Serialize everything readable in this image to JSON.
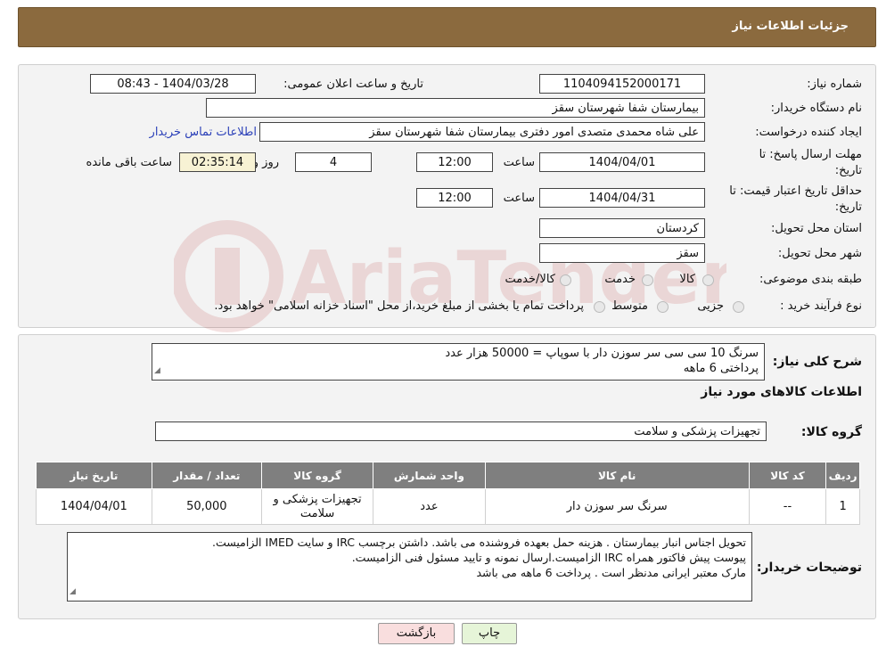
{
  "header": {
    "title": "جزئیات اطلاعات نیاز"
  },
  "fields": {
    "need_number_label": "شماره نیاز:",
    "need_number": "1104094152000171",
    "announce_label": "تاریخ و ساعت اعلان عمومی:",
    "announce_value": "1404/03/28 - 08:43",
    "buyer_org_label": "نام دستگاه خریدار:",
    "buyer_org": "بیمارستان شفا شهرستان سقز",
    "requester_label": "ایجاد کننده درخواست:",
    "requester": "علی شاه محمدی متصدی امور دفتری بیمارستان شفا شهرستان سقز",
    "contact_link": "اطلاعات تماس خریدار",
    "deadline_label_1": "مهلت ارسال پاسخ: تا",
    "deadline_label_2": "تاریخ:",
    "deadline_date": "1404/04/01",
    "time_label": "ساعت",
    "deadline_time": "12:00",
    "days_value": "4",
    "days_label": "روز و",
    "remaining_time": "02:35:14",
    "remaining_label": "ساعت باقی مانده",
    "validity_label_1": "حداقل تاریخ اعتبار قیمت: تا",
    "validity_label_2": "تاریخ:",
    "validity_date": "1404/04/31",
    "validity_time": "12:00",
    "province_label": "استان محل تحویل:",
    "province": "کردستان",
    "city_label": "شهر محل تحویل:",
    "city": "سقز",
    "category_label": "طبقه بندی موضوعی:",
    "category_options": [
      "کالا",
      "خدمت",
      "کالا/خدمت"
    ],
    "process_label": "نوع فرآیند خرید :",
    "process_options": [
      "جزیی",
      "متوسط"
    ],
    "process_note": "پرداخت تمام یا بخشی از مبلغ خرید،از محل \"اسناد خزانه اسلامی\" خواهد بود."
  },
  "summary": {
    "label": "شرح کلی نیاز:",
    "line1": "سرنگ 10 سی سی  سر سوزن دار با سوپاپ = 50000 هزار عدد",
    "line2": "پرداختی 6 ماهه"
  },
  "goods_info_title": "اطلاعات کالاهای مورد نیاز",
  "goods_group": {
    "label": "گروه کالا:",
    "value": "تجهیزات پزشکی و سلامت"
  },
  "table": {
    "headers": [
      "ردیف",
      "کد کالا",
      "نام کالا",
      "واحد شمارش",
      "گروه کالا",
      "تعداد / مقدار",
      "تاریخ نیاز"
    ],
    "rows": [
      [
        "1",
        "--",
        "سرنگ سر سوزن دار",
        "عدد",
        "تجهیزات پزشکی و سلامت",
        "50,000",
        "1404/04/01"
      ]
    ]
  },
  "buyer_notes": {
    "label": "توضیحات خریدار:",
    "line1": "تحویل اجناس  انبار بیمارستان . هزینه حمل بعهده فروشنده می باشد.  داشتن برچسب IRC  و سایت  IMED  الزامیست.",
    "line2": "پیوست پیش فاکتور همراه IRC  الزامیست.ارسال نمونه و تایید مسئول فنی الزامیست.",
    "line3": "مارک معتبر ایرانی مدنظر است . پرداخت 6 ماهه می باشد"
  },
  "buttons": {
    "print": "چاپ",
    "back": "بازگشت"
  },
  "watermark_text": "AriaTender.neT",
  "colors": {
    "header_bg": "#8b6a3e",
    "table_header_bg": "#7f7f7f",
    "time_box_bg": "#f7f2d4",
    "print_bg": "#e6f5d8",
    "back_bg": "#f9dede",
    "link": "#2a3fb8"
  }
}
